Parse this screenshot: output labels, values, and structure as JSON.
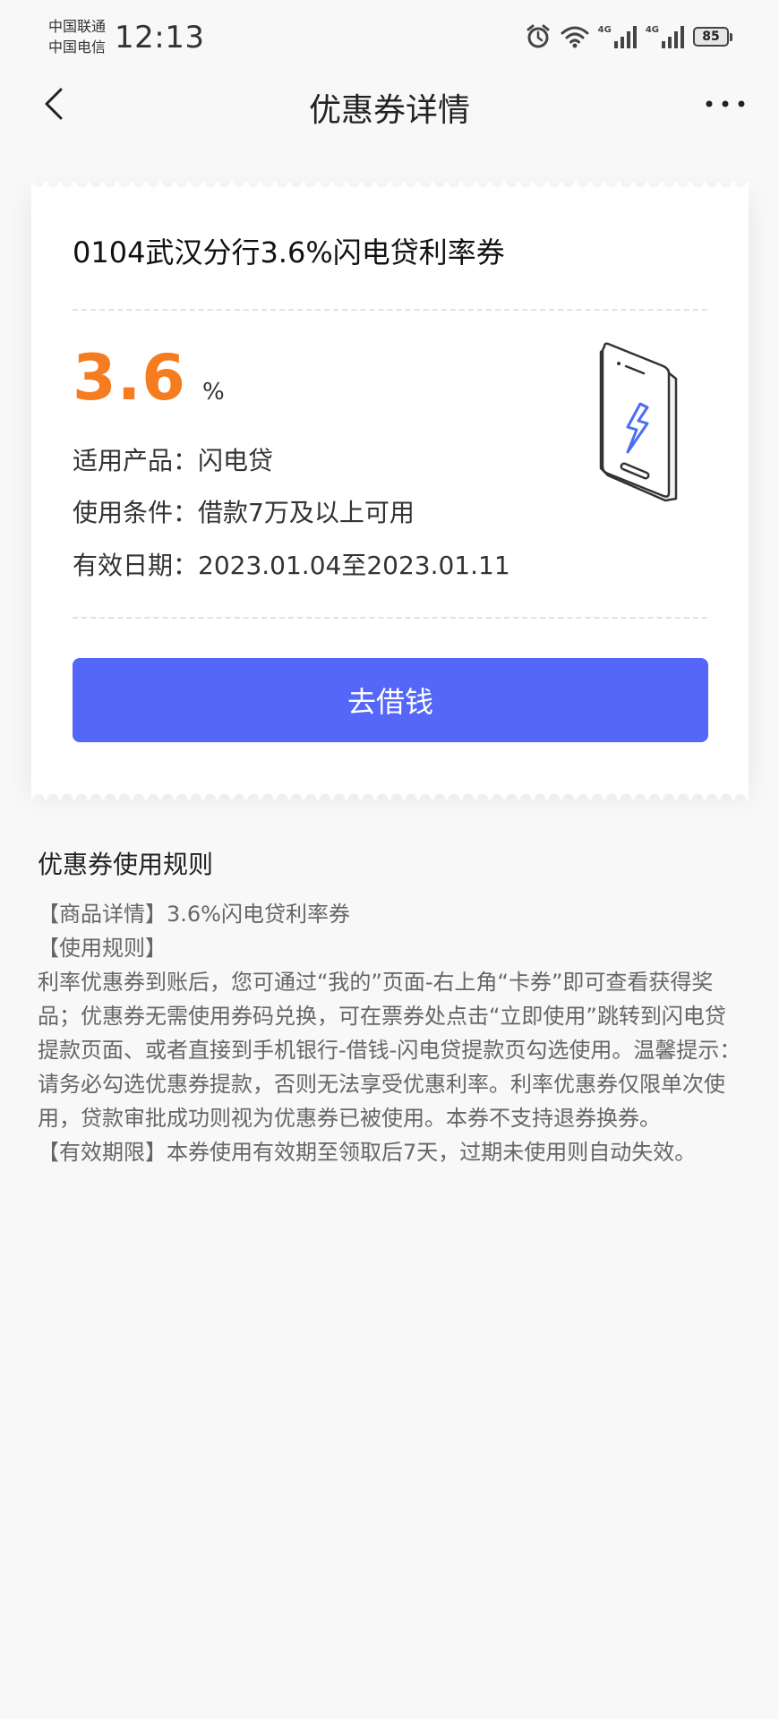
{
  "status_bar": {
    "carrier_1": "中国联通",
    "carrier_2": "中国电信",
    "time": "12:13",
    "network_1": "4G",
    "network_2": "4G",
    "battery": "85",
    "icons": [
      "alarm-icon",
      "wifi-icon",
      "signal-icon",
      "signal-icon",
      "battery-icon"
    ]
  },
  "nav": {
    "title": "优惠券详情",
    "back_icon": "chevron-left-icon",
    "more_icon": "more-icon"
  },
  "coupon": {
    "title": "0104武汉分行3.6%闪电贷利率券",
    "rate_value": "3.6",
    "rate_unit": "%",
    "product_label": "适用产品：",
    "product_value": "闪电贷",
    "condition_label": "使用条件：",
    "condition_value": "借款7万及以上可用",
    "validity_label": "有效日期：",
    "validity_value": "2023.01.04至2023.01.11",
    "button_label": "去借钱",
    "illustration_icon": "phone-lightning-icon",
    "accent_color": "#f57c1f",
    "button_color": "#5467f8"
  },
  "rules": {
    "title": "优惠券使用规则",
    "line_1": "【商品详情】3.6%闪电贷利率券",
    "line_2": "【使用规则】",
    "line_3": "利率优惠券到账后，您可通过“我的”页面-右上角“卡券”即可查看获得奖品；优惠券无需使用券码兑换，可在票券处点击“立即使用”跳转到闪电贷提款页面、或者直接到手机银行-借钱-闪电贷提款页勾选使用。温馨提示：请务必勾选优惠券提款，否则无法享受优惠利率。利率优惠券仅限单次使用，贷款审批成功则视为优惠券已被使用。本券不支持退券换券。",
    "line_4": "【有效期限】本券使用有效期至领取后7天，过期未使用则自动失效。"
  }
}
